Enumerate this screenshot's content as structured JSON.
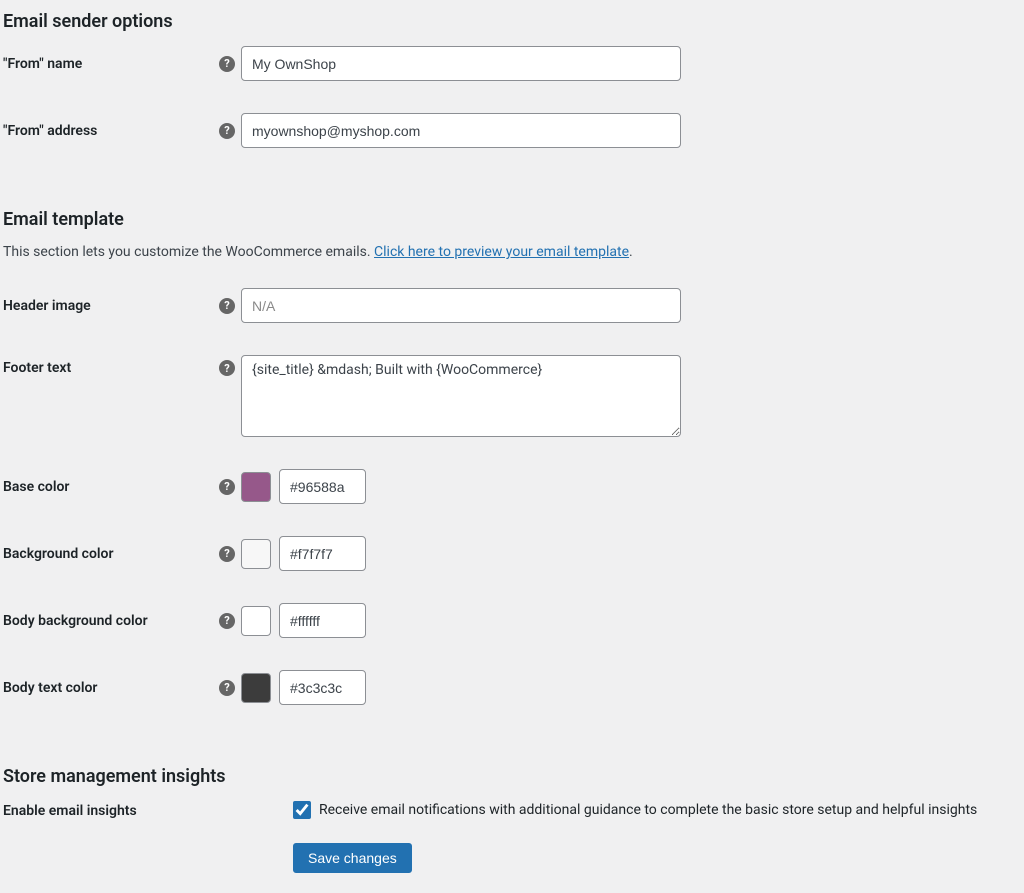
{
  "sections": {
    "sender": {
      "heading": "Email sender options"
    },
    "template": {
      "heading": "Email template",
      "desc_prefix": "This section lets you customize the WooCommerce emails. ",
      "desc_link": "Click here to preview your email template",
      "desc_suffix": "."
    },
    "insights": {
      "heading": "Store management insights"
    }
  },
  "fields": {
    "from_name": {
      "label": "\"From\" name",
      "value": "My OwnShop"
    },
    "from_address": {
      "label": "\"From\" address",
      "value": "myownshop@myshop.com"
    },
    "header_image": {
      "label": "Header image",
      "placeholder": "N/A",
      "value": ""
    },
    "footer_text": {
      "label": "Footer text",
      "value": "{site_title} &mdash; Built with {WooCommerce}"
    },
    "base_color": {
      "label": "Base color",
      "value": "#96588a",
      "swatch": "#96588a"
    },
    "bg_color": {
      "label": "Background color",
      "value": "#f7f7f7",
      "swatch": "#f7f7f7"
    },
    "body_bg": {
      "label": "Body background color",
      "value": "#ffffff",
      "swatch": "#ffffff"
    },
    "body_text": {
      "label": "Body text color",
      "value": "#3c3c3c",
      "swatch": "#3c3c3c"
    }
  },
  "insights": {
    "label": "Enable email insights",
    "checked": true,
    "desc": "Receive email notifications with additional guidance to complete the basic store setup and helpful insights"
  },
  "buttons": {
    "save": "Save changes"
  }
}
